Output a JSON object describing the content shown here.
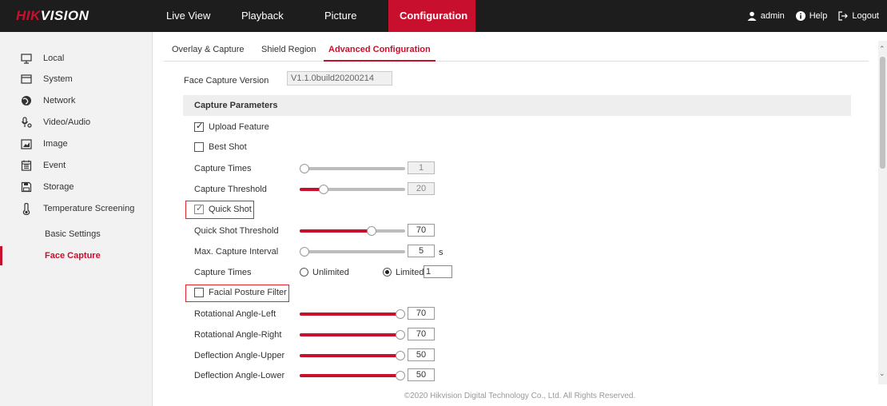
{
  "brand": {
    "logo_part1": "HIK",
    "logo_part2": "VISION"
  },
  "nav": {
    "items": [
      "Live View",
      "Playback",
      "Picture",
      "Configuration"
    ],
    "active": "Configuration"
  },
  "user": {
    "username": "admin",
    "help": "Help",
    "logout": "Logout"
  },
  "sidebar": {
    "items": [
      {
        "label": "Local",
        "icon": "monitor-icon"
      },
      {
        "label": "System",
        "icon": "system-icon"
      },
      {
        "label": "Network",
        "icon": "globe-icon"
      },
      {
        "label": "Video/Audio",
        "icon": "microphone-icon"
      },
      {
        "label": "Image",
        "icon": "image-icon"
      },
      {
        "label": "Event",
        "icon": "calendar-icon"
      },
      {
        "label": "Storage",
        "icon": "floppy-disk-icon"
      },
      {
        "label": "Temperature Screening",
        "icon": "thermometer-icon"
      }
    ],
    "sub_items": [
      "Basic Settings",
      "Face Capture"
    ],
    "active_sub": "Face Capture"
  },
  "tabs": [
    "Overlay & Capture",
    "Shield Region",
    "Advanced Configuration"
  ],
  "active_tab": "Advanced Configuration",
  "form": {
    "version_label": "Face Capture Version",
    "version_value": "V1.1.0build20200214",
    "section_title": "Capture Parameters",
    "upload_feature": {
      "label": "Upload Feature",
      "checked": true
    },
    "best_shot": {
      "label": "Best Shot",
      "checked": false
    },
    "capture_times_slider": {
      "label": "Capture Times",
      "value": "1",
      "level": 0.0
    },
    "capture_threshold": {
      "label": "Capture Threshold",
      "value": "20",
      "level": 0.2
    },
    "quick_shot": {
      "label": "Quick Shot",
      "checked": true
    },
    "quick_shot_threshold": {
      "label": "Quick Shot Threshold",
      "value": "70",
      "level": 0.7
    },
    "max_capture_interval": {
      "label": "Max. Capture Interval",
      "value": "5",
      "unit": "s",
      "level": 0.0
    },
    "capture_times_mode": {
      "label": "Capture Times",
      "unlimited": "Unlimited",
      "limited": "Limited",
      "limited_value": "1",
      "selected": "Limited"
    },
    "facial_posture_filter": {
      "label": "Facial Posture Filter",
      "checked": false
    },
    "rotational_left": {
      "label": "Rotational Angle-Left",
      "value": "70",
      "level": 1.0
    },
    "rotational_right": {
      "label": "Rotational Angle-Right",
      "value": "70",
      "level": 1.0
    },
    "deflection_upper": {
      "label": "Deflection Angle-Upper",
      "value": "50",
      "level": 1.0
    },
    "deflection_lower": {
      "label": "Deflection Angle-Lower",
      "value": "50",
      "level": 1.0
    }
  },
  "footer": "©2020 Hikvision Digital Technology Co., Ltd. All Rights Reserved.",
  "colors": {
    "accent": "#c8102e",
    "topbar": "#1d1d1d",
    "highlight_box": "#e5232d"
  }
}
